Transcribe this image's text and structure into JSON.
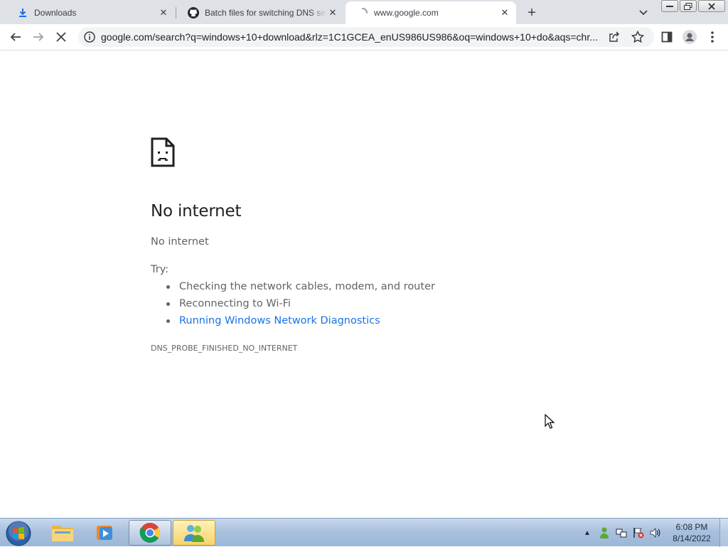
{
  "tabs": [
    {
      "title": "Downloads",
      "icon": "download-icon",
      "active": false
    },
    {
      "title": "Batch files for switching DNS ser",
      "icon": "github-icon",
      "active": false
    },
    {
      "title": "www.google.com",
      "icon": "loading-spinner-icon",
      "active": true
    }
  ],
  "toolbar": {
    "url": "google.com/search?q=windows+10+download&rlz=1C1GCEA_enUS986US986&oq=windows+10+do&aqs=chr..."
  },
  "error_page": {
    "title": "No internet",
    "subtitle": "No internet",
    "try_label": "Try:",
    "suggestions": [
      {
        "text": "Checking the network cables, modem, and router",
        "link": false
      },
      {
        "text": "Reconnecting to Wi-Fi",
        "link": false
      },
      {
        "text": "Running Windows Network Diagnostics",
        "link": true
      }
    ],
    "error_code": "DNS_PROBE_FINISHED_NO_INTERNET"
  },
  "taskbar": {
    "apps": [
      "windows-explorer",
      "media-player",
      "chrome",
      "windows-live-messenger"
    ],
    "clock": {
      "time": "6:08 PM",
      "date": "8/14/2022"
    }
  },
  "colors": {
    "tab_strip": "#dee1e6",
    "link_blue": "#1a73e8",
    "text_gray": "#5f6368",
    "title_dark": "#202124"
  }
}
